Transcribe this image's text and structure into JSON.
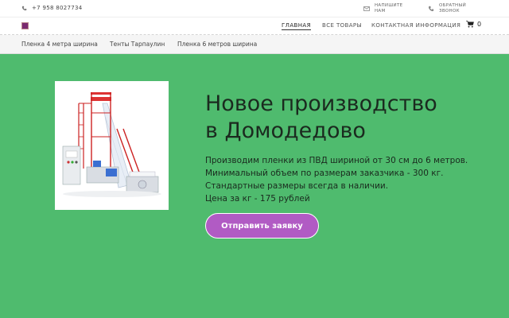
{
  "topbar": {
    "phone": "+7 958 8027734",
    "write_us": [
      "НАПИШИТЕ",
      "НАМ"
    ],
    "callback": [
      "ОБРАТНЫЙ",
      "ЗВОНОК"
    ]
  },
  "nav": {
    "items": [
      {
        "label": "ГЛАВНАЯ",
        "active": true
      },
      {
        "label": "ВСЕ ТОВАРЫ",
        "active": false
      },
      {
        "label": "КОНТАКТНАЯ ИНФОРМАЦИЯ",
        "active": false
      }
    ],
    "cart_count": "0"
  },
  "categories": [
    "Пленка 4 метра ширина",
    "Тенты Тарпаулин",
    "Пленка 6 метров ширина"
  ],
  "hero": {
    "title_line1": "Новое производство",
    "title_line2": "в Домодедово",
    "text": [
      "Производим пленки из ПВД шириной от 30 см до 6 метров.",
      "Минимальный объем по размерам заказчика - 300 кг.",
      "Стандартные размеры всегда в наличии.",
      "Цена за кг - 175 рублей"
    ],
    "cta_label": "Отправить заявку"
  },
  "colors": {
    "hero_bg": "#4fbb6e",
    "cta_bg": "#b15bc4",
    "logo": "#7a2a6f"
  },
  "icons": {
    "phone": "phone-icon",
    "mail": "mail-icon",
    "callback": "callback-phone-icon",
    "cart": "cart-icon",
    "logo": "logo-icon"
  }
}
